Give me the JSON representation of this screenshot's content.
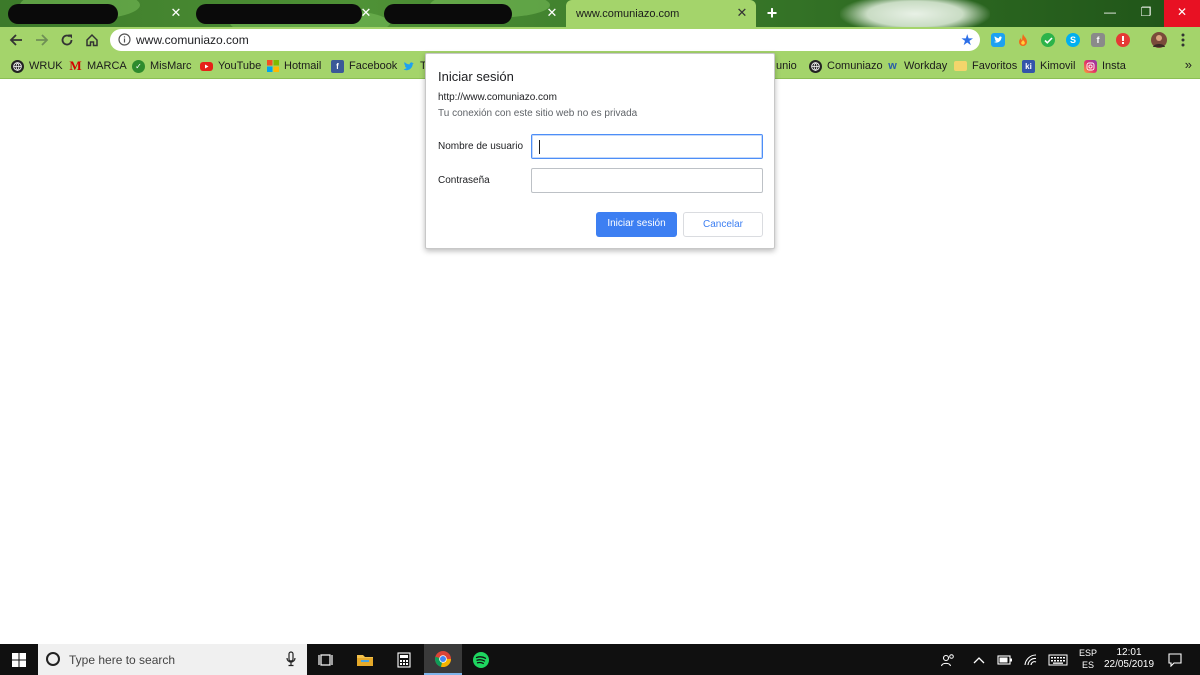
{
  "browser": {
    "active_tab_title": "www.comuniazo.com",
    "new_tab_symbol": "+",
    "close_symbol": "✕",
    "window_controls": {
      "minimize": "—",
      "restore": "❐",
      "close": "✕"
    }
  },
  "omnibox": {
    "url": "www.comuniazo.com",
    "star": "★"
  },
  "bookmarks": [
    {
      "label": "WRUK",
      "icon": "globe-icon",
      "color": "#222222"
    },
    {
      "label": "MARCA",
      "icon": "marca-icon",
      "color": "#d30000"
    },
    {
      "label": "MisMarc",
      "icon": "mismarc-icon",
      "color": "#2e8b2e"
    },
    {
      "label": "YouTube",
      "icon": "youtube-icon",
      "color": "#e62117"
    },
    {
      "label": "Hotmail",
      "icon": "microsoft-icon",
      "color": "#f25022"
    },
    {
      "label": "Facebook",
      "icon": "facebook-icon",
      "color": "#3b5998"
    },
    {
      "label": "T",
      "icon": "twitter-icon",
      "color": "#1da1f2"
    },
    {
      "label": "unio",
      "icon": "",
      "color": ""
    },
    {
      "label": "Comuniazo",
      "icon": "globe-icon",
      "color": "#222222"
    },
    {
      "label": "Workday",
      "icon": "workday-icon",
      "color": "#f5a623"
    },
    {
      "label": "Favoritos",
      "icon": "folder-icon",
      "color": "#f3d56b"
    },
    {
      "label": "Kimovil",
      "icon": "kimovil-icon",
      "color": "#3355aa"
    },
    {
      "label": "Insta",
      "icon": "instagram-icon",
      "color": "#c13584"
    }
  ],
  "bookmarks_more": "»",
  "dialog": {
    "title": "Iniciar sesión",
    "site": "http://www.comuniazo.com",
    "warning": "Tu conexión con este sitio web no es privada",
    "username_label": "Nombre de usuario",
    "username_value": "",
    "password_label": "Contraseña",
    "password_value": "",
    "submit_label": "Iniciar sesión",
    "cancel_label": "Cancelar"
  },
  "taskbar": {
    "search_placeholder": "Type here to search",
    "language_top": "ESP",
    "language_bottom": "ES",
    "time": "12:01",
    "date": "22/05/2019"
  },
  "colors": {
    "chrome_green": "#a4d46b",
    "accent_blue": "#3d7ff2",
    "taskbar": "#101010"
  }
}
